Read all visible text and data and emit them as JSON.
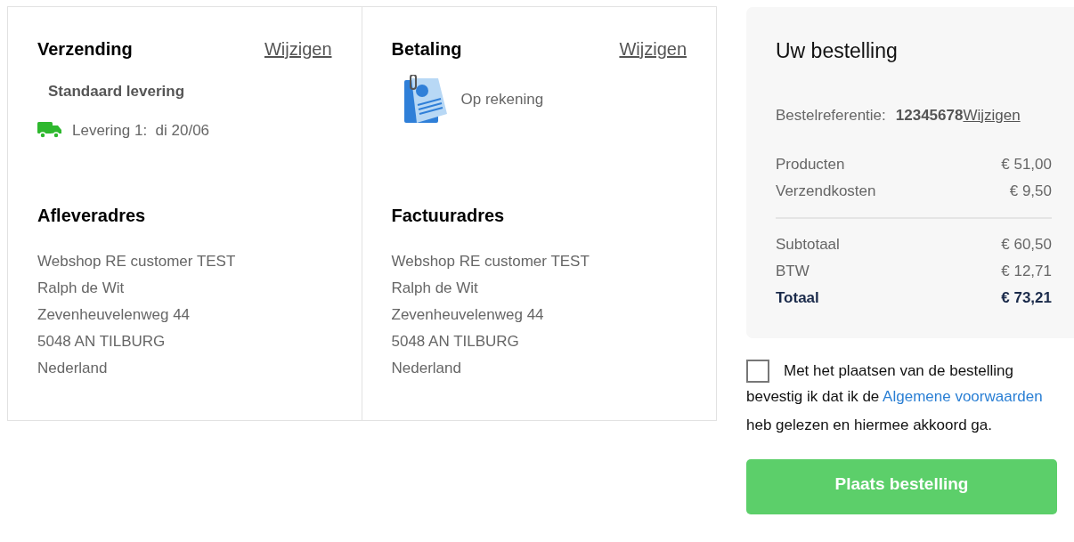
{
  "sections": [
    {
      "title": "Verzending",
      "link": "Wijzigen",
      "kind": "shipping",
      "method": "Standaard levering",
      "delivery": "Levering 1:  di 20/06"
    },
    {
      "title": "Betaling",
      "link": "Wijzigen",
      "kind": "payment",
      "method": "Op rekening"
    },
    {
      "title": "Afleveradres",
      "kind": "address",
      "lines": [
        "Webshop RE customer TEST",
        "Ralph de Wit",
        "Zevenheuvelenweg 44",
        "5048 AN TILBURG",
        "Nederland"
      ]
    },
    {
      "title": "Factuuradres",
      "kind": "address",
      "lines": [
        "Webshop RE customer TEST",
        "Ralph de Wit",
        "Zevenheuvelenweg 44",
        "5048 AN TILBURG",
        "Nederland"
      ]
    }
  ],
  "summary": {
    "title": "Uw bestelling",
    "reference_label": "Bestelreferentie:",
    "reference": "12345678",
    "reference_link": "Wijzigen",
    "groups": [
      [
        {
          "label": "Producten",
          "value": "€ 51,00",
          "bold": false
        },
        {
          "label": "Verzendkosten",
          "value": "€ 9,50",
          "bold": false
        }
      ],
      [
        {
          "label": "Subtotaal",
          "value": "€ 60,50",
          "bold": false
        },
        {
          "label": "BTW",
          "value": "€ 12,71",
          "bold": false
        },
        {
          "label": "Totaal",
          "value": "€ 73,21",
          "bold": true
        }
      ]
    ]
  },
  "terms": {
    "checked": false,
    "first_line": "Met het plaatsen van de bestelling",
    "text_before": "bevestig ik dat ik de",
    "link": "Algemene voorwaarden",
    "text_after": "heb gelezen en hiermee akkoord ga."
  },
  "submit": "Plaats bestelling"
}
